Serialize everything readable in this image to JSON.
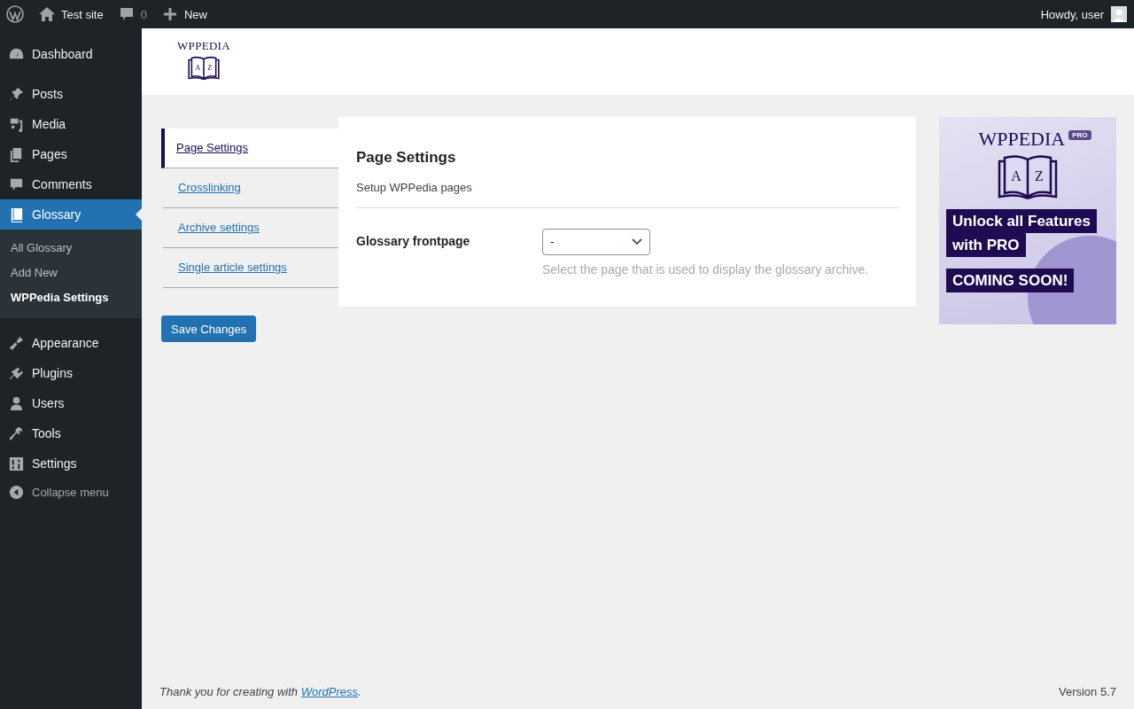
{
  "admin_bar": {
    "site_name": "Test site",
    "comments_count": "0",
    "new_label": "New",
    "greeting": "Howdy, user"
  },
  "menu": [
    {
      "items": [
        {
          "label": "Dashboard",
          "selected": false
        }
      ]
    },
    {
      "items": [
        {
          "label": "Posts",
          "selected": false
        },
        {
          "label": "Media",
          "selected": false
        },
        {
          "label": "Pages",
          "selected": false
        },
        {
          "label": "Comments",
          "selected": false
        },
        {
          "label": "Glossary",
          "selected": true,
          "children": [
            {
              "label": "All Glossary",
              "selected": false
            },
            {
              "label": "Add New",
              "selected": false
            },
            {
              "label": "WPPedia Settings",
              "selected": true
            }
          ]
        }
      ]
    },
    {
      "items": [
        {
          "label": "Appearance",
          "selected": false
        },
        {
          "label": "Plugins",
          "selected": false
        },
        {
          "label": "Users",
          "selected": false
        },
        {
          "label": "Tools",
          "selected": false
        },
        {
          "label": "Settings",
          "selected": false
        }
      ]
    }
  ],
  "collapse_label": "Collapse menu",
  "logo": {
    "wordmark": "WPPEDIA",
    "letters": [
      "A",
      "Z"
    ]
  },
  "tabs": [
    {
      "label": "Page Settings",
      "selected": true
    },
    {
      "label": "Crosslinking",
      "selected": false
    },
    {
      "label": "Archive settings",
      "selected": false
    },
    {
      "label": "Single article settings",
      "selected": false
    }
  ],
  "section": {
    "title": "Page Settings",
    "description": "Setup WPPedia pages",
    "fields": [
      {
        "label": "Glossary frontpage",
        "value": "-",
        "help": "Select the page that is used to display the glossary archive."
      }
    ]
  },
  "save_button": "Save Changes",
  "promo": {
    "wordmark": "WPPEDIA",
    "badge": "PRO",
    "letters": [
      "A",
      "Z"
    ],
    "headline": [
      "Unlock all Features",
      "with PRO"
    ],
    "tagline": "COMING SOON!"
  },
  "footer": {
    "prefix": "Thank you for creating with ",
    "link": "WordPress",
    "suffix": ".",
    "version": "Version 5.7"
  }
}
